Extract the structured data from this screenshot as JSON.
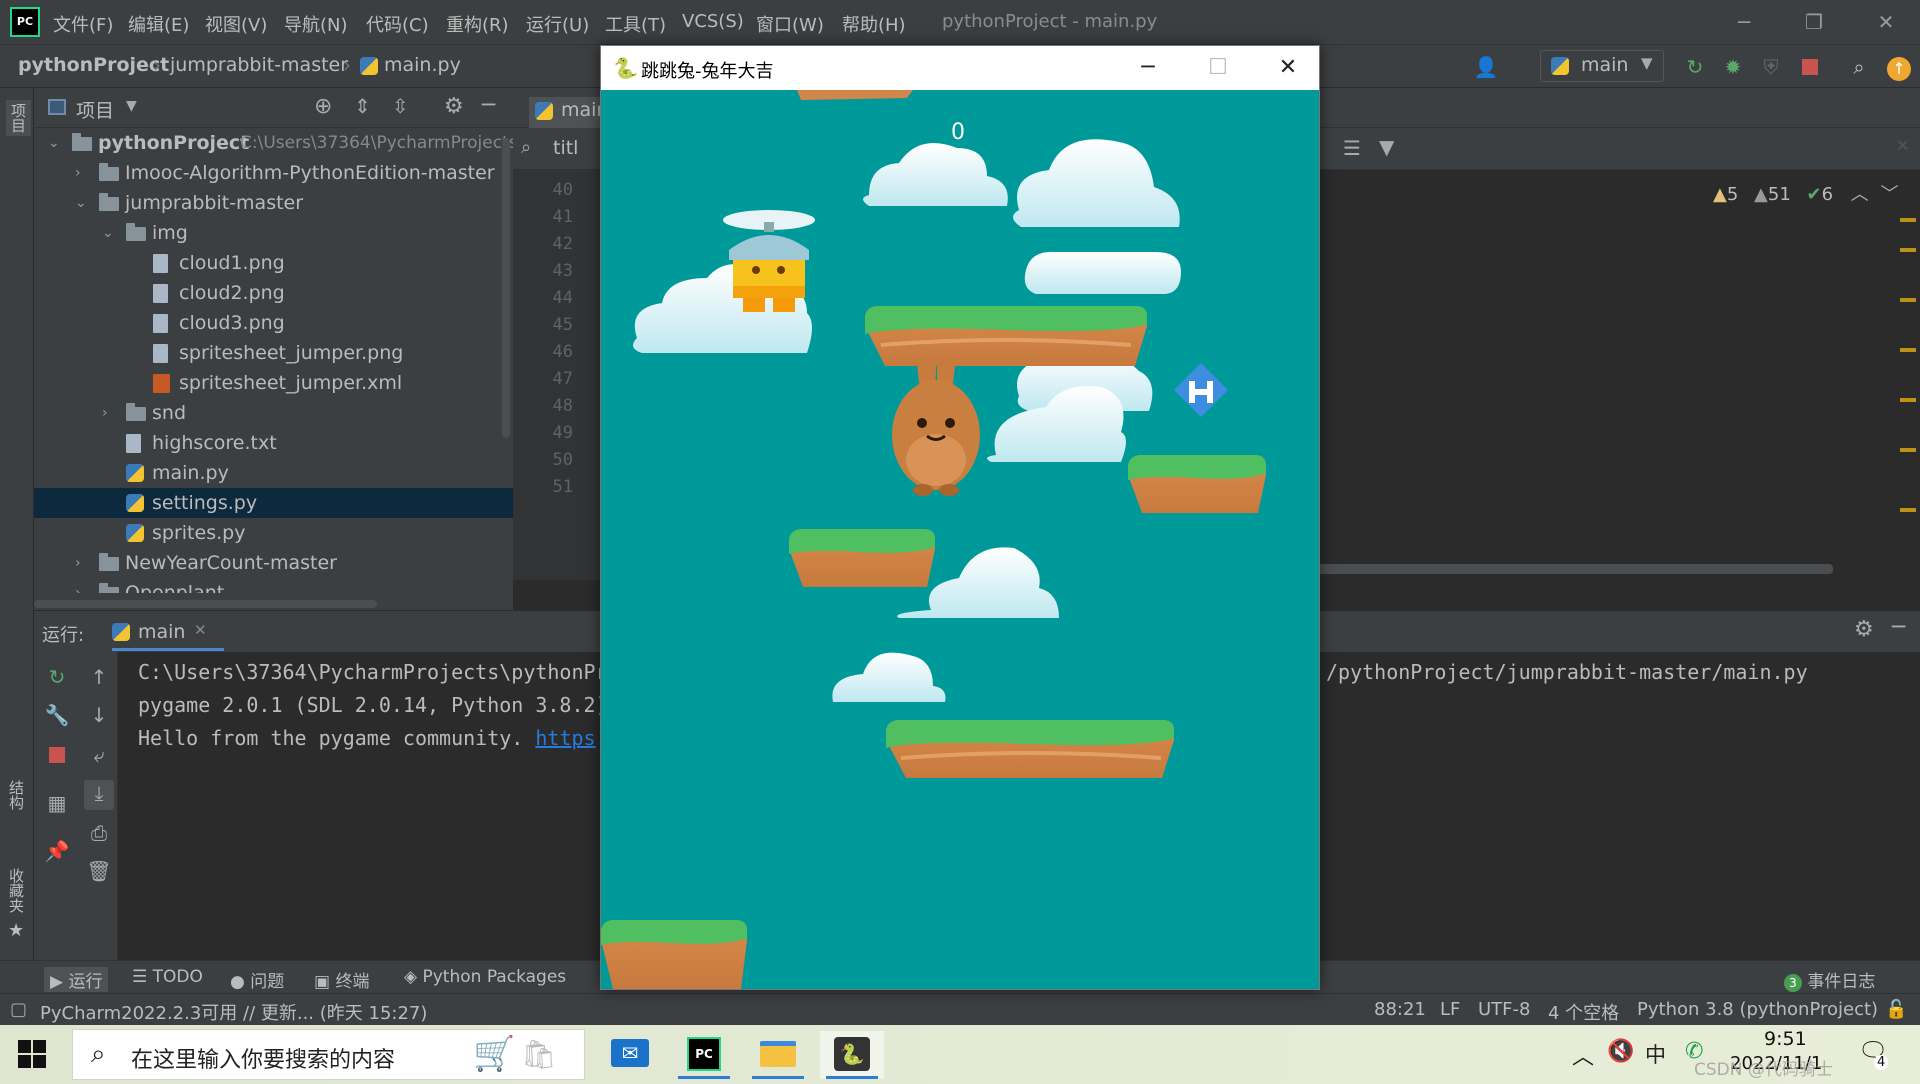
{
  "menubar": {
    "items": [
      "文件(F)",
      "编辑(E)",
      "视图(V)",
      "导航(N)",
      "代码(C)",
      "重构(R)",
      "运行(U)",
      "工具(T)",
      "VCS(S)",
      "窗口(W)",
      "帮助(H)"
    ],
    "title": "pythonProject - main.py"
  },
  "breadcrumb": {
    "project": "pythonProject",
    "folder": "jumprabbit-master",
    "file": "main.py"
  },
  "toolbar": {
    "run_config": "main"
  },
  "left_stripe": {
    "project": "项目",
    "structure": "结构",
    "bookmarks": "收藏夹"
  },
  "project_panel": {
    "title": "项目",
    "tree": [
      {
        "label": "pythonProject",
        "path": "C:\\Users\\37364\\PycharmProjects",
        "kind": "folder",
        "depth": 0,
        "expanded": true
      },
      {
        "label": "Imooc-Algorithm-PythonEdition-master",
        "kind": "folder",
        "depth": 1,
        "expanded": false
      },
      {
        "label": "jumprabbit-master",
        "kind": "folder",
        "depth": 1,
        "expanded": true
      },
      {
        "label": "img",
        "kind": "folder",
        "depth": 2,
        "expanded": true
      },
      {
        "label": "cloud1.png",
        "kind": "file",
        "depth": 3
      },
      {
        "label": "cloud2.png",
        "kind": "file",
        "depth": 3
      },
      {
        "label": "cloud3.png",
        "kind": "file",
        "depth": 3
      },
      {
        "label": "spritesheet_jumper.png",
        "kind": "file",
        "depth": 3
      },
      {
        "label": "spritesheet_jumper.xml",
        "kind": "xml",
        "depth": 3
      },
      {
        "label": "snd",
        "kind": "folder",
        "depth": 2,
        "expanded": false
      },
      {
        "label": "highscore.txt",
        "kind": "file",
        "depth": 2
      },
      {
        "label": "main.py",
        "kind": "py",
        "depth": 2
      },
      {
        "label": "settings.py",
        "kind": "py",
        "depth": 2,
        "selected": true
      },
      {
        "label": "sprites.py",
        "kind": "py",
        "depth": 2
      },
      {
        "label": "NewYearCount-master",
        "kind": "folder",
        "depth": 1,
        "expanded": false
      },
      {
        "label": "Openplant",
        "kind": "folder",
        "depth": 1,
        "expanded": false
      }
    ]
  },
  "editor": {
    "tab": "main",
    "find_query": "titl",
    "line_numbers": [
      "40",
      "41",
      "42",
      "43",
      "44",
      "45",
      "46",
      "47",
      "48",
      "49",
      "50",
      "51"
    ],
    "warnings": "5",
    "weak_warnings": "51",
    "ok_count": "6"
  },
  "run_panel": {
    "label": "运行:",
    "tab": "main",
    "console": {
      "line1_left": "C:\\Users\\37364\\PycharmProjects\\pythonPr",
      "line1_right": "/pythonProject/jumprabbit-master/main.py",
      "line2": "pygame 2.0.1 (SDL 2.0.14, Python 3.8.2)",
      "line3": "Hello from the pygame community. ",
      "line3_link": "https"
    }
  },
  "bottom_tabs": {
    "run": "运行",
    "todo": "TODO",
    "problems": "问题",
    "terminal": "终端",
    "packages": "Python Packages",
    "event_log_count": "3",
    "event_log": "事件日志"
  },
  "statusbar": {
    "message": "PyCharm2022.2.3可用 // 更新... (昨天 15:27)",
    "position": "88:21",
    "line_sep": "LF",
    "encoding": "UTF-8",
    "indent": "4 个空格",
    "interpreter": "Python 3.8 (pythonProject)"
  },
  "taskbar": {
    "search_placeholder": "在这里输入你要搜索的内容",
    "time": "9:51",
    "date": "2022/11/1",
    "watermark": "CSDN @代码骑士",
    "notification_count": "4",
    "ime": "中"
  },
  "game_window": {
    "title": "跳跳兔-兔年大吉",
    "score": "0",
    "background": "#009999"
  }
}
